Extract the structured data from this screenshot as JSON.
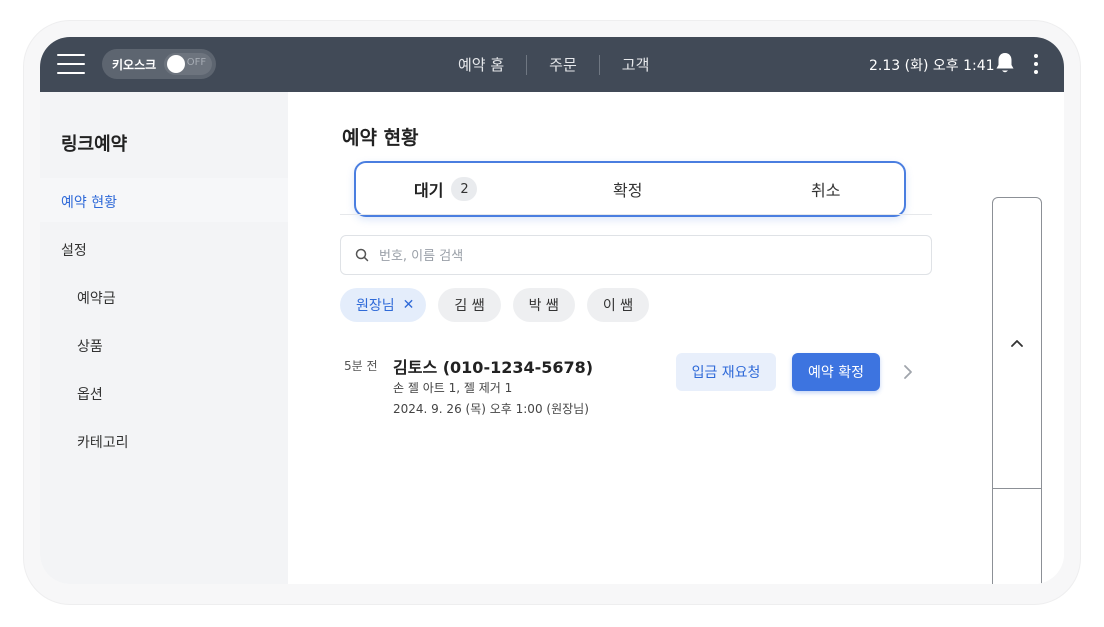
{
  "topbar": {
    "kiosk_label": "키오스크",
    "kiosk_state": "OFF",
    "nav": [
      "예약 홈",
      "주문",
      "고객"
    ],
    "clock": "2.13 (화) 오후 1:41",
    "icons": {
      "menu": "hamburger-menu-icon",
      "bell": "bell-icon",
      "more": "kebab-menu-icon"
    }
  },
  "sidebar": {
    "title": "링크예약",
    "items": [
      {
        "label": "예약 현황",
        "active": true
      },
      {
        "label": "설정"
      },
      {
        "label": "예약금"
      },
      {
        "label": "상품"
      },
      {
        "label": "옵션"
      },
      {
        "label": "카테고리"
      }
    ]
  },
  "main": {
    "title": "예약 현황",
    "tabs": [
      {
        "label": "대기",
        "badge": "2",
        "active": true
      },
      {
        "label": "확정"
      },
      {
        "label": "취소"
      }
    ],
    "search": {
      "placeholder": "번호, 이름 검색",
      "value": ""
    },
    "filters": [
      {
        "label": "원장님",
        "selected": true
      },
      {
        "label": "김 쌤"
      },
      {
        "label": "박 쌤"
      },
      {
        "label": "이 쌤"
      }
    ],
    "reservation": {
      "time_ago": "5분 전",
      "name": "김토스 (010-1234-5678)",
      "services": "손 젤 아트 1, 젤 제거 1",
      "datetime": "2024. 9. 26 (목) 오후 1:00 (원장님)",
      "rerequest_label": "입금 재요청",
      "confirm_label": "예약 확정"
    }
  },
  "colors": {
    "topbar_bg": "#414a57",
    "accent": "#3d74e0",
    "sidebar_bg": "#f3f4f6"
  }
}
